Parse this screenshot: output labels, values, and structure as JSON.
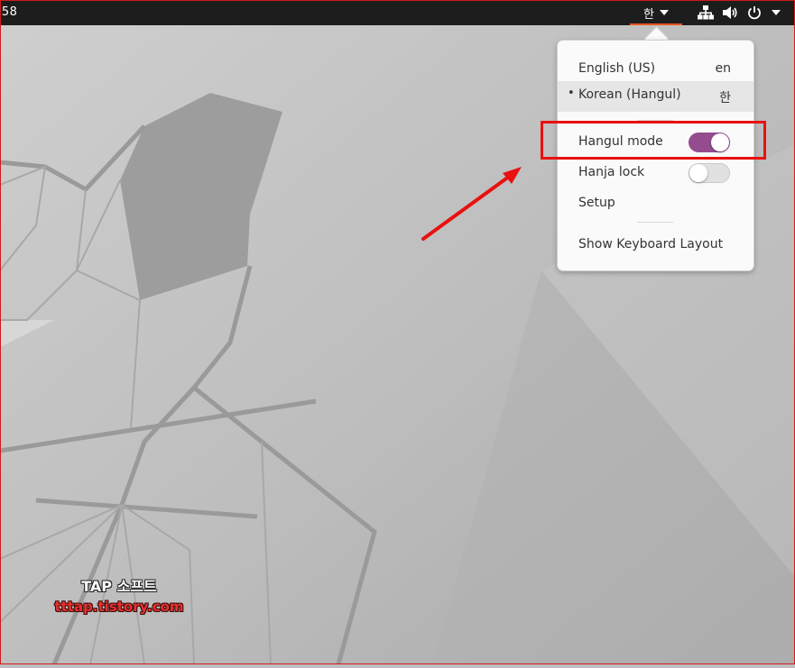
{
  "topbar": {
    "clock_fragment": ":58",
    "input_source_indicator": "한",
    "icons": [
      "network-icon",
      "volume-icon",
      "power-icon",
      "chevron-down-icon"
    ]
  },
  "input_menu": {
    "sources": [
      {
        "label": "English (US)",
        "code": "en",
        "active": false
      },
      {
        "label": "Korean (Hangul)",
        "code": "한",
        "active": true
      }
    ],
    "active_bullet": "•",
    "hangul_mode": {
      "label": "Hangul mode",
      "enabled": true
    },
    "hanja_lock": {
      "label": "Hanja lock",
      "enabled": false
    },
    "setup_label": "Setup",
    "show_layout_label": "Show Keyboard Layout"
  },
  "watermark": {
    "line1": "TAP 소프트",
    "line2": "tttap.tistory.com"
  },
  "colors": {
    "topbar_bg": "#1d1d1d",
    "accent_orange": "#e95420",
    "toggle_on": "#944c8f",
    "annotation_red": "#e8110f"
  }
}
